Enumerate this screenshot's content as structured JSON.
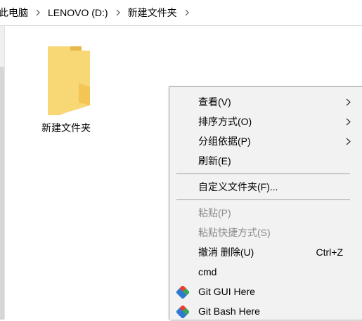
{
  "breadcrumb": {
    "items": [
      "此电脑",
      "LENOVO (D:)",
      "新建文件夹"
    ]
  },
  "folder": {
    "label": "新建文件夹"
  },
  "context_menu": {
    "view": "查看(V)",
    "sort_by": "排序方式(O)",
    "group_by": "分组依据(P)",
    "refresh": "刷新(E)",
    "customize_folder": "自定义文件夹(F)...",
    "paste": "粘贴(P)",
    "paste_shortcut": "粘贴快捷方式(S)",
    "undo_delete": "撤消 删除(U)",
    "undo_delete_shortcut": "Ctrl+Z",
    "cmd": "cmd",
    "git_gui": "Git GUI Here",
    "git_bash": "Git Bash Here"
  },
  "icons": {
    "breadcrumb_separator": "chevron-right-icon",
    "submenu": "chevron-right-icon",
    "folder": "folder-icon",
    "git": "git-icon"
  },
  "colors": {
    "folder_front": "#f8d775",
    "folder_back": "#e8b84a",
    "menu_bg": "#f2f2f2",
    "disabled_text": "#8a8a8a",
    "git_red": "#f03c2e",
    "git_blue": "#2e7ad1",
    "git_green": "#3aa757"
  }
}
